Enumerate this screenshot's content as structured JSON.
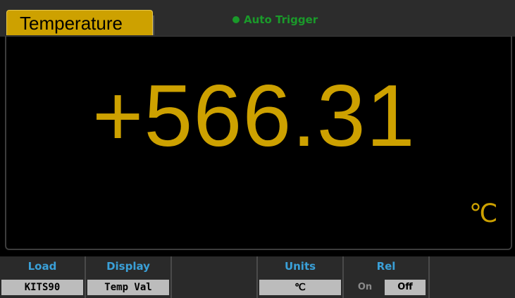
{
  "header": {
    "mode_tab": "Temperature",
    "trigger_label": "Auto Trigger",
    "trigger_indicator_color": "#1a9a2a"
  },
  "display": {
    "reading": "+566.31",
    "unit": "℃",
    "reading_color": "#cda100"
  },
  "softkeys": {
    "load": {
      "title": "Load",
      "value": "KITS90"
    },
    "display": {
      "title": "Display",
      "value": "Temp Val"
    },
    "blank1": {
      "title": ""
    },
    "units": {
      "title": "Units",
      "value": "℃"
    },
    "rel": {
      "title": "Rel",
      "on_label": "On",
      "off_label": "Off",
      "selected": "Off"
    },
    "blank2": {
      "title": ""
    }
  }
}
